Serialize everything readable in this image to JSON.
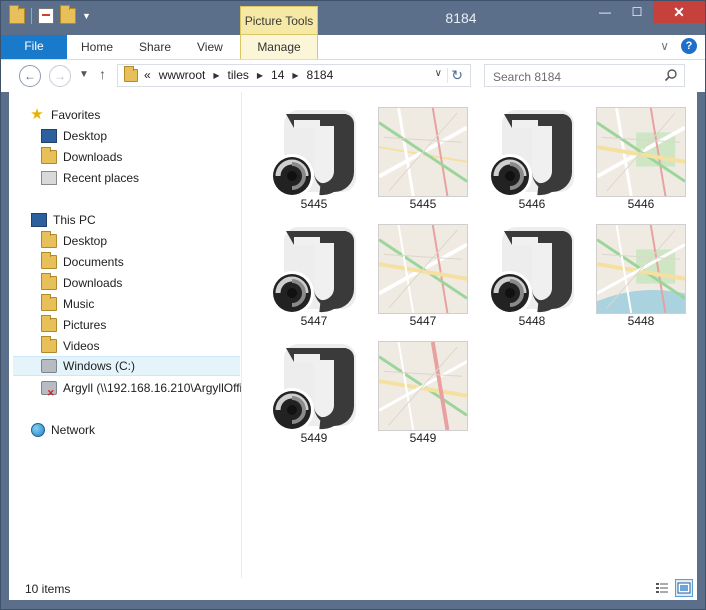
{
  "window": {
    "title": "8184",
    "context_tab": "Picture Tools"
  },
  "ribbon": {
    "file": "File",
    "home": "Home",
    "share": "Share",
    "view": "View",
    "manage": "Manage"
  },
  "address": {
    "overflow": "«",
    "crumbs": [
      "wwwroot",
      "tiles",
      "14",
      "8184"
    ]
  },
  "search": {
    "placeholder": "Search 8184"
  },
  "nav": {
    "favorites": "Favorites",
    "fav_items": [
      "Desktop",
      "Downloads",
      "Recent places"
    ],
    "this_pc": "This PC",
    "pc_items": [
      "Desktop",
      "Documents",
      "Downloads",
      "Music",
      "Pictures",
      "Videos",
      "Windows (C:)",
      "Argyll (\\\\192.168.16.210\\ArgyllOffi"
    ],
    "network": "Network"
  },
  "files": [
    {
      "name": "5445",
      "type": "script"
    },
    {
      "name": "5445",
      "type": "map"
    },
    {
      "name": "5446",
      "type": "script"
    },
    {
      "name": "5446",
      "type": "map"
    },
    {
      "name": "5447",
      "type": "script"
    },
    {
      "name": "5447",
      "type": "map"
    },
    {
      "name": "5448",
      "type": "script"
    },
    {
      "name": "5448",
      "type": "map"
    },
    {
      "name": "5449",
      "type": "script"
    },
    {
      "name": "5449",
      "type": "map"
    }
  ],
  "status": {
    "items": "10 items"
  },
  "colors": {
    "title_bar": "#5c6f8a",
    "file_tab": "#1979ca",
    "picture_tools": "#f6e9a6",
    "close_button": "#c6413b",
    "selection": "#e5f3fb"
  }
}
